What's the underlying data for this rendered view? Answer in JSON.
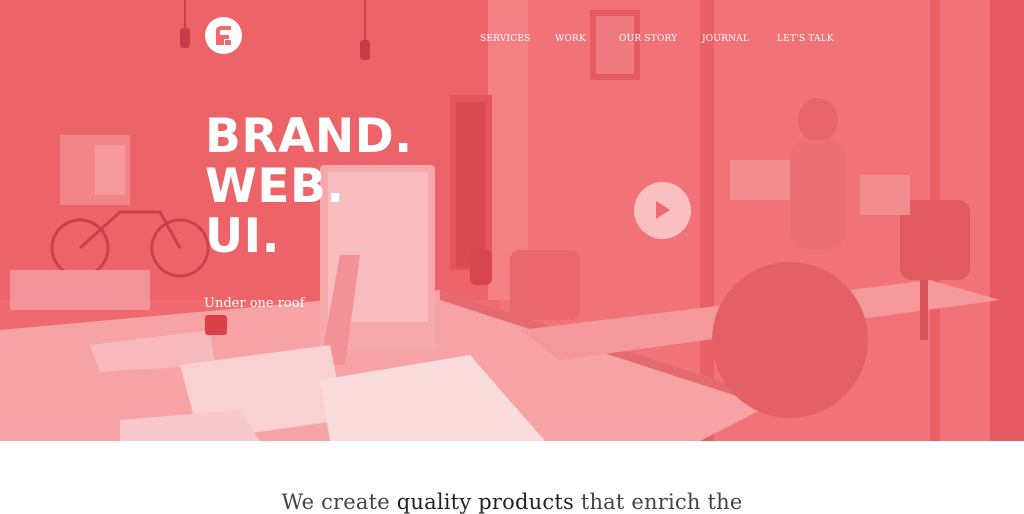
{
  "colors": {
    "hero_overlay": "#ef6a6f",
    "text_light": "#ffffff",
    "text_dark": "#444444"
  },
  "header": {
    "logo_icon": "brand-logo-icon",
    "nav": [
      {
        "label": "SERVICES"
      },
      {
        "label": "WORK"
      },
      {
        "label": "OUR STORY"
      },
      {
        "label": "JOURNAL"
      },
      {
        "label": "LET'S TALK"
      }
    ]
  },
  "hero": {
    "headline": [
      "BRAND.",
      "WEB.",
      "UI."
    ],
    "subline": "Under one roof",
    "play_icon": "play-icon"
  },
  "intro": {
    "part1": "We create ",
    "emphasis": "quality products",
    "part2": " that enrich the"
  }
}
